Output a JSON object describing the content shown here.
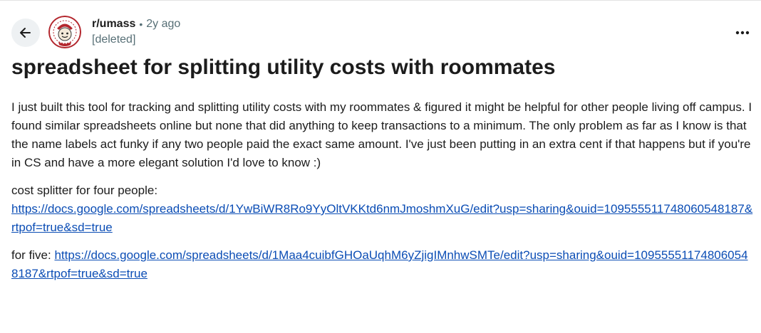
{
  "header": {
    "subreddit": "r/umass",
    "separator": "•",
    "age": "2y ago",
    "author": "[deleted]"
  },
  "icons": {
    "back": "arrow-left-icon",
    "avatar": "subreddit-avatar-icon",
    "overflow": "more-horizontal-icon"
  },
  "post": {
    "title": "spreadsheet for splitting utility costs with roommates",
    "paragraph1": "I just built this tool for tracking and splitting utility costs with my roommates & figured it might be helpful for other people living off campus. I found similar spreadsheets online but none that did anything to keep transactions to a minimum. The only problem as far as I know is that the name labels act funky if any two people paid the exact same amount. I've just been putting in an extra cent if that happens but if you're in CS and have a more elegant solution I'd love to know :)",
    "four_label": "cost splitter for four people:",
    "four_link": "https://docs.google.com/spreadsheets/d/1YwBiWR8Ro9YyOltVKKtd6nmJmoshmXuG/edit?usp=sharing&ouid=109555511748060548187&rtpof=true&sd=true",
    "five_label": "for five: ",
    "five_link": "https://docs.google.com/spreadsheets/d/1Maa4cuibfGHOaUqhM6yZjigIMnhwSMTe/edit?usp=sharing&ouid=109555511748060548187&rtpof=true&sd=true"
  },
  "colors": {
    "link": "#0b4db5",
    "muted": "#576f76",
    "back_button_bg": "#eef1f3",
    "avatar_red": "#b3262d"
  }
}
